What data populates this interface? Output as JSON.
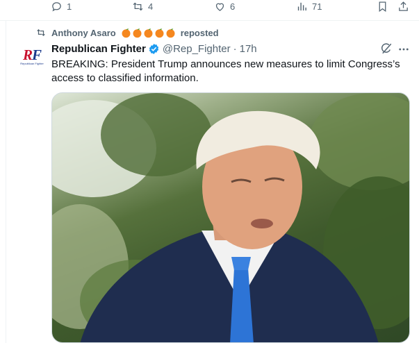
{
  "previous_tweet_actions": {
    "replies": "1",
    "reposts": "4",
    "likes": "6",
    "views": "71"
  },
  "repost_banner": {
    "name": "Anthony Asaro",
    "emoji_icon": "orange-emoji",
    "emoji_count": 5,
    "label": "reposted"
  },
  "tweet": {
    "avatar_text": "RF",
    "avatar_subtext": "Republican Fighter",
    "display_name": "Republican Fighter",
    "handle": "@Rep_Fighter",
    "separator": "·",
    "time": "17h",
    "text": "BREAKING: President Trump announces new measures to limit Congress’s access to classified information.",
    "media_icon": "photo",
    "verified_color": "#1d9bf0"
  },
  "icons": {
    "reply": "reply-icon",
    "repost": "repost-icon",
    "like": "heart-icon",
    "views": "views-chart-icon",
    "bookmark": "bookmark-icon",
    "share": "share-icon",
    "grok": "grok-icon",
    "more": "more-icon"
  }
}
